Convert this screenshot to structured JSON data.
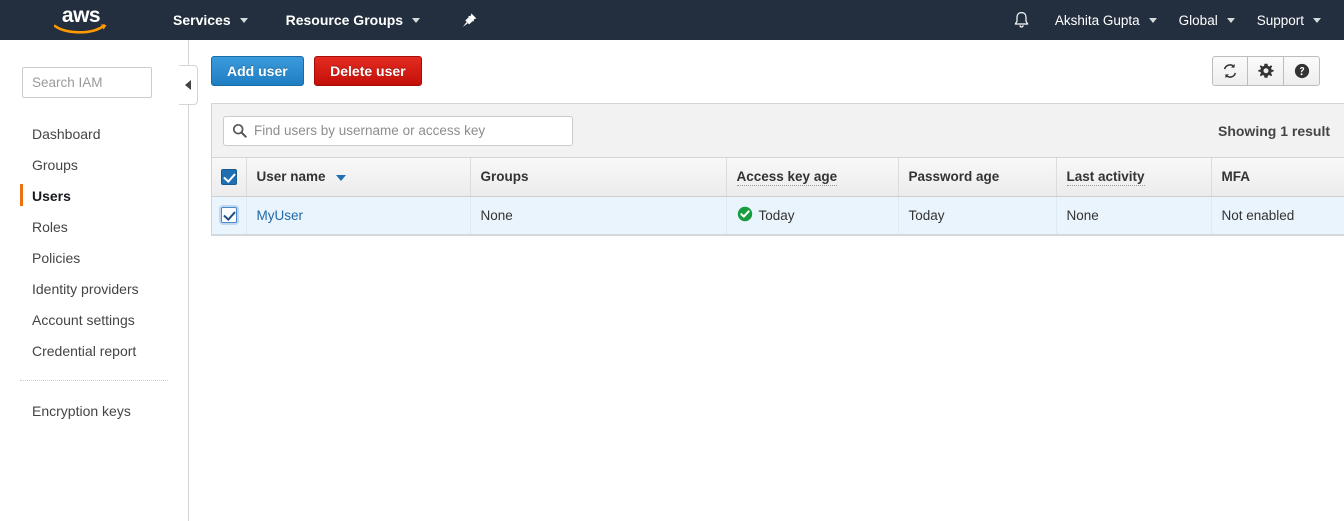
{
  "topnav": {
    "logo_text": "aws",
    "logo_icon": "aws-logo",
    "services_label": "Services",
    "resource_groups_label": "Resource Groups",
    "pin_icon": "pin-icon",
    "bell_icon": "bell-icon",
    "account_label": "Akshita Gupta",
    "region_label": "Global",
    "support_label": "Support"
  },
  "sidebar": {
    "search_placeholder": "Search IAM",
    "search_value": "",
    "search_icon": "search-icon",
    "collapse_icon": "chevron-left-icon",
    "items": [
      {
        "label": "Dashboard",
        "active": false
      },
      {
        "label": "Groups",
        "active": false
      },
      {
        "label": "Users",
        "active": true
      },
      {
        "label": "Roles",
        "active": false
      },
      {
        "label": "Policies",
        "active": false
      },
      {
        "label": "Identity providers",
        "active": false
      },
      {
        "label": "Account settings",
        "active": false
      },
      {
        "label": "Credential report",
        "active": false
      }
    ],
    "items_after_divider": [
      {
        "label": "Encryption keys",
        "active": false
      }
    ]
  },
  "toolbar": {
    "add_user_label": "Add user",
    "delete_user_label": "Delete user",
    "refresh_icon": "refresh-icon",
    "settings_icon": "gear-icon",
    "help_icon": "help-icon"
  },
  "filter": {
    "search_placeholder": "Find users by username or access key",
    "search_value": "",
    "search_icon": "search-icon",
    "showing_results": "Showing 1 result"
  },
  "table": {
    "select_all_checked": true,
    "columns": [
      {
        "label": "User name",
        "sorted": true,
        "tooltip": false
      },
      {
        "label": "Groups",
        "sorted": false,
        "tooltip": false
      },
      {
        "label": "Access key age",
        "sorted": false,
        "tooltip": true
      },
      {
        "label": "Password age",
        "sorted": false,
        "tooltip": false
      },
      {
        "label": "Last activity",
        "sorted": false,
        "tooltip": true
      },
      {
        "label": "MFA",
        "sorted": false,
        "tooltip": false
      }
    ],
    "rows": [
      {
        "selected": true,
        "user_name": "MyUser",
        "groups": "None",
        "access_key_age": "Today",
        "access_key_status_icon": "green-check-icon",
        "password_age": "Today",
        "last_activity": "None",
        "mfa": "Not enabled"
      }
    ]
  },
  "colors": {
    "nav_bg": "#232f3e",
    "accent_orange": "#ec7211",
    "primary_button": "#1f7ec2",
    "danger_button": "#c4100a",
    "link": "#2068a8",
    "selected_row": "#eaf4fd",
    "status_green": "#179c3e"
  }
}
